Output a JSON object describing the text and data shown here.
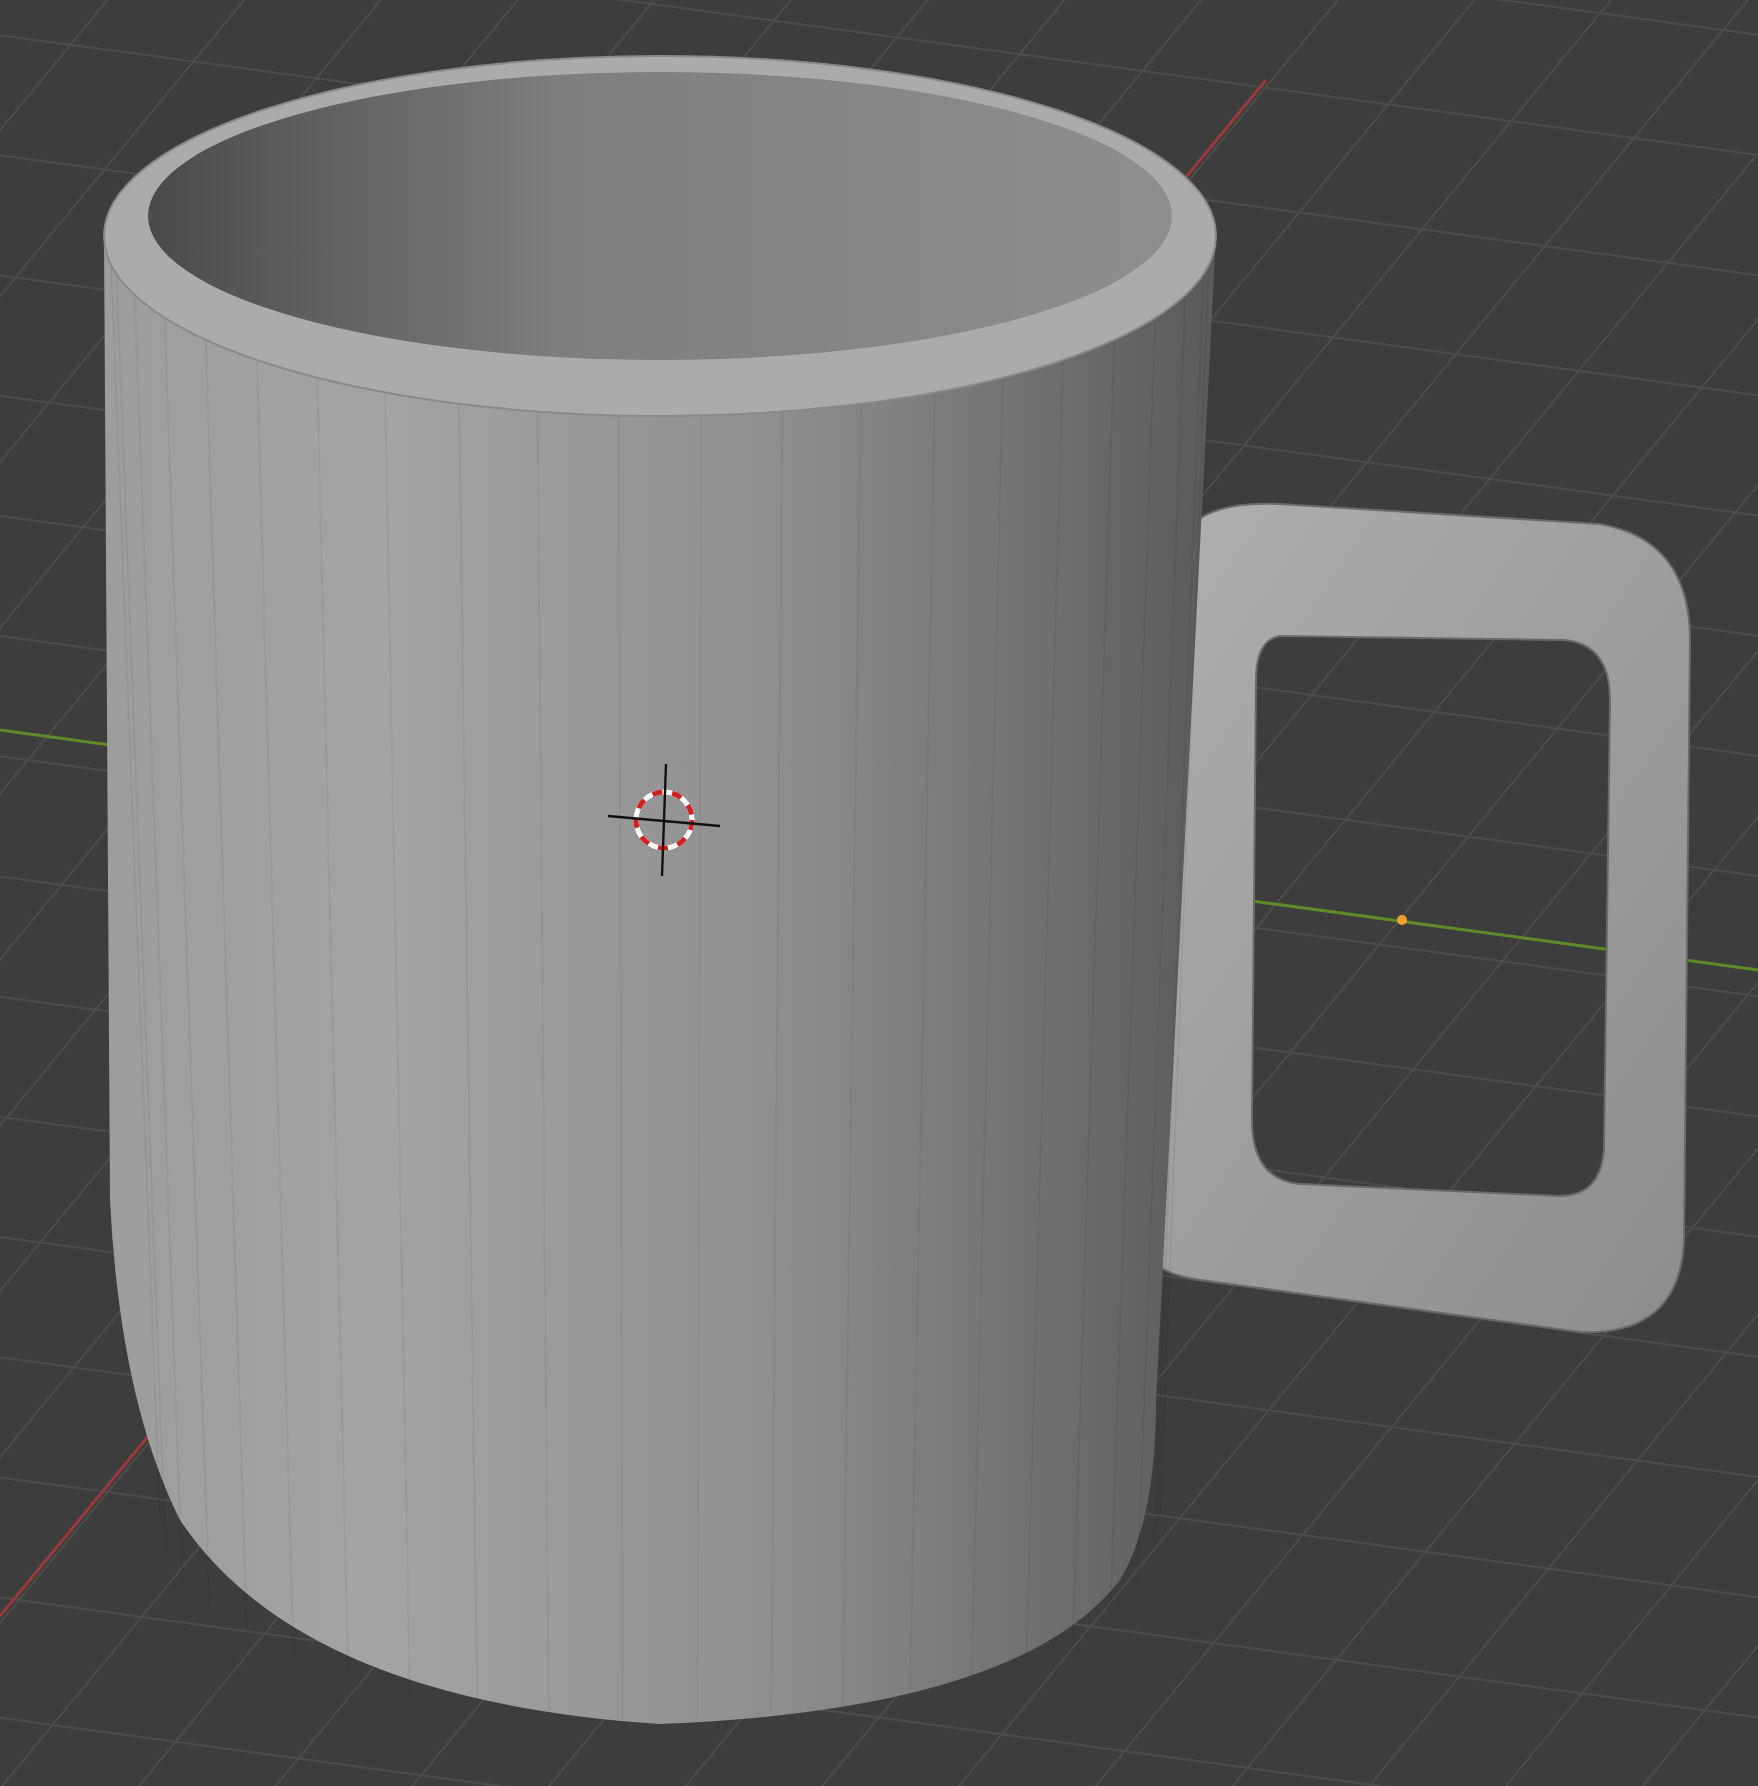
{
  "viewport": {
    "kind": "perspective",
    "object": {
      "kind": "mug"
    }
  }
}
